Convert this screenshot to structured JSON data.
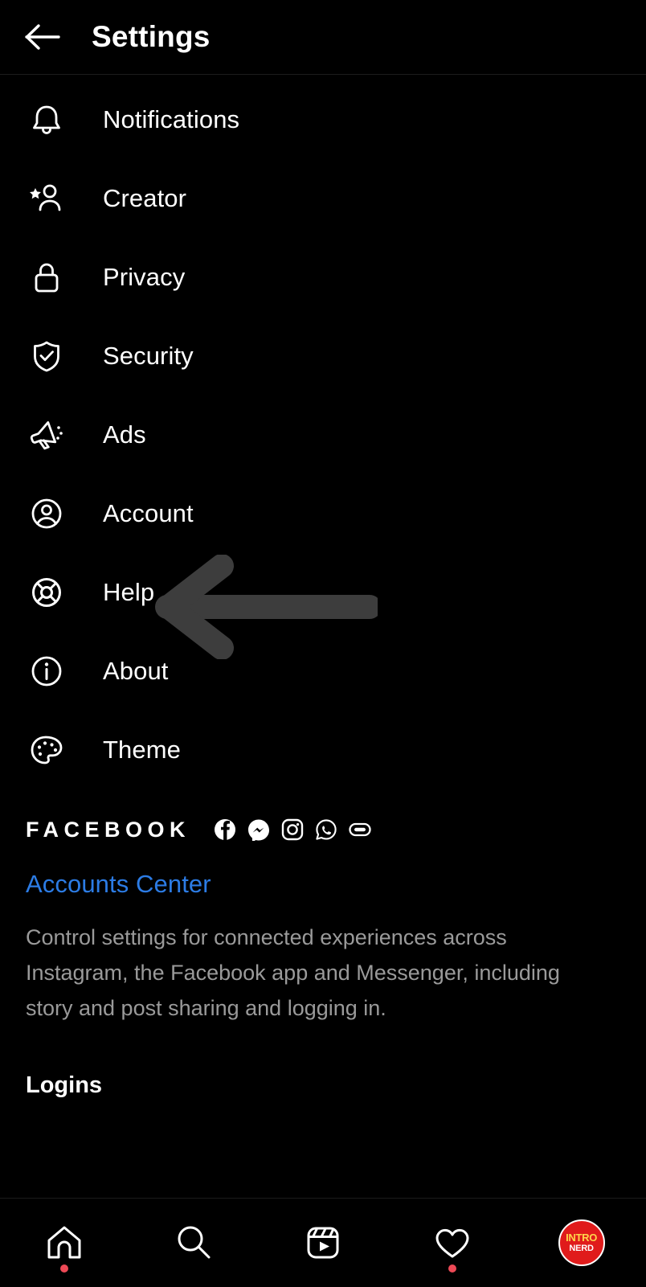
{
  "header": {
    "back_icon": "arrow-left-icon",
    "title": "Settings"
  },
  "settings_items": [
    {
      "label": "Notifications",
      "icon": "bell-icon"
    },
    {
      "label": "Creator",
      "icon": "creator-star-person-icon"
    },
    {
      "label": "Privacy",
      "icon": "lock-icon"
    },
    {
      "label": "Security",
      "icon": "shield-check-icon"
    },
    {
      "label": "Ads",
      "icon": "megaphone-icon"
    },
    {
      "label": "Account",
      "icon": "account-circle-icon"
    },
    {
      "label": "Help",
      "icon": "life-ring-icon"
    },
    {
      "label": "About",
      "icon": "info-circle-icon"
    },
    {
      "label": "Theme",
      "icon": "palette-icon"
    }
  ],
  "annotation": {
    "type": "arrow-left-annotation",
    "points_at": "Help",
    "color": "#3d3d3d"
  },
  "facebook_section": {
    "wordmark": "FACEBOOK",
    "app_icons": [
      "facebook-icon",
      "messenger-icon",
      "instagram-icon",
      "whatsapp-icon",
      "portal-icon"
    ],
    "accounts_center_link": "Accounts Center",
    "accounts_center_color": "#2c7ce5",
    "description": "Control settings for connected experiences across Instagram, the Facebook app and Messenger, including story and post sharing and logging in.",
    "logins_heading": "Logins"
  },
  "bottom_nav": {
    "items": [
      {
        "icon": "home-icon",
        "badge": true
      },
      {
        "icon": "search-icon",
        "badge": false
      },
      {
        "icon": "reels-icon",
        "badge": false
      },
      {
        "icon": "heart-icon",
        "badge": true
      },
      {
        "icon": "profile-avatar",
        "badge": false
      }
    ],
    "avatar": {
      "top_text": "INTRO",
      "bottom_text": "NERD",
      "bg_color": "#e01b1b"
    }
  }
}
